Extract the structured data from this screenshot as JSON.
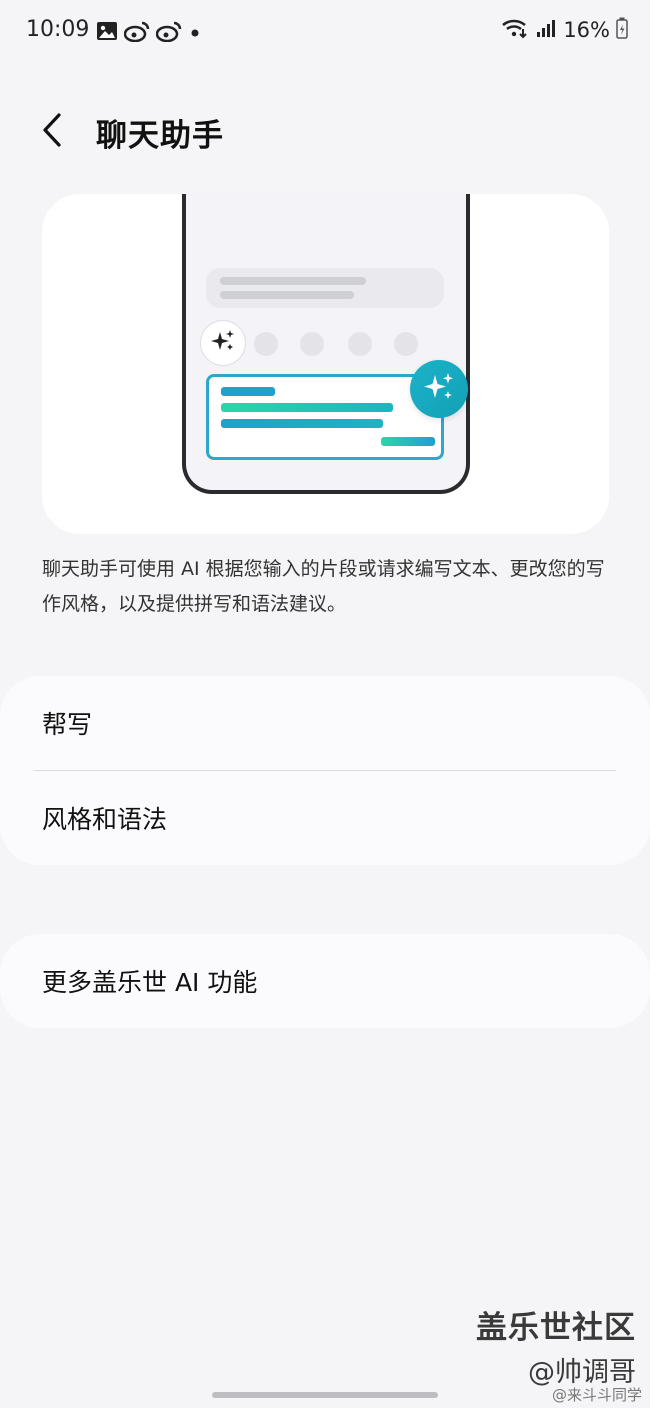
{
  "status_bar": {
    "time": "10:09",
    "battery": "16%",
    "left_icons": [
      "gallery-icon",
      "weibo-icon",
      "weibo-icon",
      "dot-icon"
    ],
    "right_icons": [
      "wifi-icon",
      "signal-icon",
      "battery-icon"
    ]
  },
  "header": {
    "title": "聊天助手",
    "back_icon": "chevron-left-icon"
  },
  "illustration": {
    "accent_colors": [
      "#1fa0d0",
      "#2bd6a8",
      "#13a0b6"
    ]
  },
  "description": "聊天助手可使用 AI 根据您输入的片段或请求编写文本、更改您的写作风格，以及提供拼写和语法建议。",
  "settings": {
    "items": [
      {
        "label": "帮写"
      },
      {
        "label": "风格和语法"
      }
    ]
  },
  "more": {
    "label": "更多盖乐世 AI 功能"
  },
  "watermark": {
    "community": "盖乐世社区",
    "author": "@帅调哥",
    "weibo": "@来斗斗同学"
  }
}
